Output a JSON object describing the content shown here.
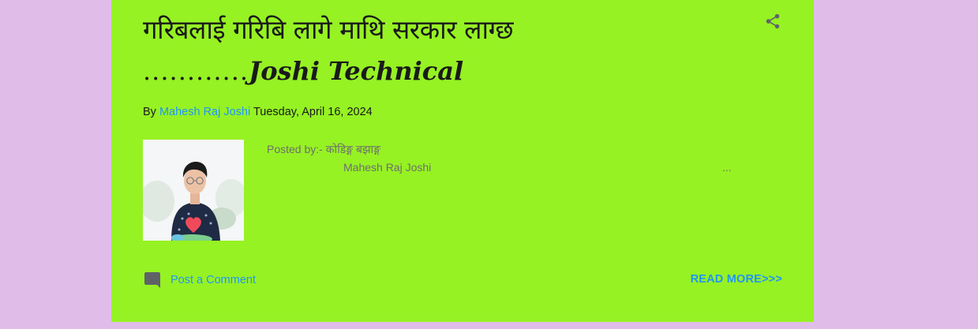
{
  "post": {
    "title_line1": "गरिबलाई गरिबि लागे माथि सरकार लाग्छ",
    "title_dots": "............",
    "title_line2": "Joshi Technical",
    "share_icon": "share-icon",
    "byline": {
      "by_label": "By",
      "author": "Mahesh Raj Joshi",
      "date": "Tuesday, April 16, 2024"
    },
    "snippet": {
      "line1": "Posted by:- कोडिङ्ग बझाङ्ग",
      "line2": "Mahesh Raj Joshi",
      "ellipsis": "..."
    },
    "comment_label": "Post a Comment",
    "read_more_label": "READ MORE>>>"
  },
  "colors": {
    "page_background": "#e0bde8",
    "card_background": "#96f223",
    "link": "#2196f3",
    "snippet_text": "#6e6e6e",
    "icon": "#5f6368"
  }
}
